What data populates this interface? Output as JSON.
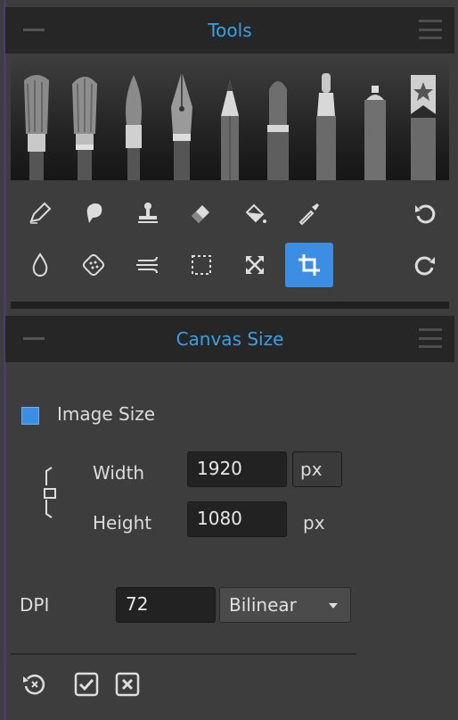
{
  "tools_panel": {
    "title": "Tools",
    "brushes": [
      "brush-flat",
      "brush-round",
      "brush-fine",
      "pen-nib",
      "pencil",
      "marker",
      "felt-tip",
      "spray-can",
      "favorites-star"
    ],
    "tool_rows": [
      [
        "pencil-tool-icon",
        "smudge-tool-icon",
        "stamp-tool-icon",
        "eraser-tool-icon",
        "fill-tool-icon",
        "eyedropper-tool-icon",
        "undo-icon"
      ],
      [
        "blur-tool-icon",
        "texture-tool-icon",
        "blend-tool-icon",
        "selection-tool-icon",
        "transform-tool-icon",
        "crop-tool-icon",
        "redo-icon"
      ]
    ],
    "active_tool": "crop-tool-icon"
  },
  "canvas_panel": {
    "title": "Canvas Size",
    "image_size_label": "Image Size",
    "image_size_checked": true,
    "width_label": "Width",
    "width_value": "1920",
    "width_unit": "px",
    "height_label": "Height",
    "height_value": "1080",
    "height_unit": "px",
    "dpi_label": "DPI",
    "dpi_value": "72",
    "resample_value": "Bilinear"
  },
  "colors": {
    "accent": "#3aa0e8",
    "active": "#3b8ee3",
    "panel": "#3d3d3d",
    "header": "#262626"
  }
}
